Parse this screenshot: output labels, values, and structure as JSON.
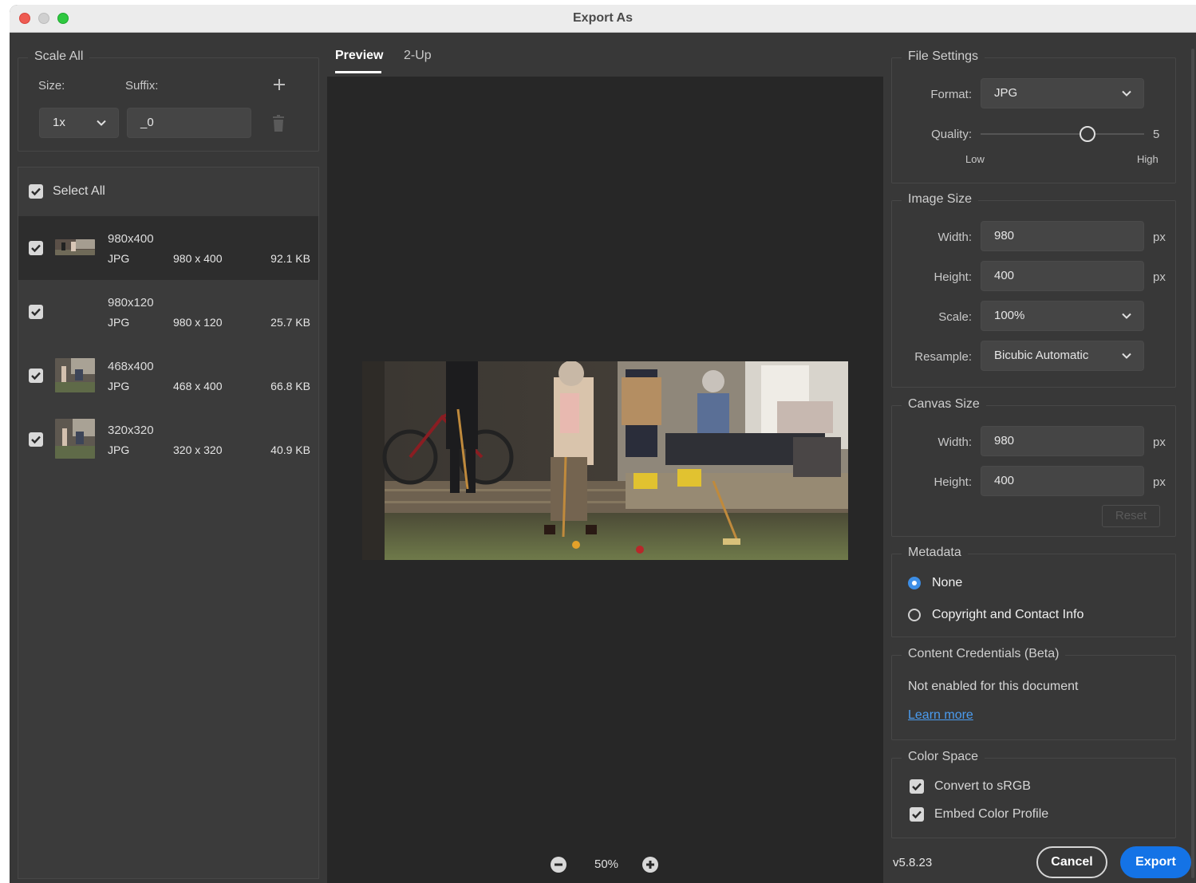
{
  "window": {
    "title": "Export As"
  },
  "scale_all": {
    "title": "Scale All",
    "size_label": "Size:",
    "suffix_label": "Suffix:",
    "size_value": "1x",
    "suffix_value": "_0"
  },
  "assets": {
    "select_all_label": "Select All",
    "items": [
      {
        "name": "980x400",
        "format": "JPG",
        "dimensions": "980 x 400",
        "filesize": "92.1 KB",
        "checked": true,
        "selected": true
      },
      {
        "name": "980x120",
        "format": "JPG",
        "dimensions": "980 x 120",
        "filesize": "25.7 KB",
        "checked": true,
        "selected": false
      },
      {
        "name": "468x400",
        "format": "JPG",
        "dimensions": "468 x 400",
        "filesize": "66.8 KB",
        "checked": true,
        "selected": false
      },
      {
        "name": "320x320",
        "format": "JPG",
        "dimensions": "320 x 320",
        "filesize": "40.9 KB",
        "checked": true,
        "selected": false
      }
    ]
  },
  "preview": {
    "tabs": [
      {
        "label": "Preview",
        "active": true
      },
      {
        "label": "2-Up",
        "active": false
      }
    ],
    "zoom_level": "50%"
  },
  "file_settings": {
    "title": "File Settings",
    "format_label": "Format:",
    "format_value": "JPG",
    "quality_label": "Quality:",
    "quality_value": "5",
    "quality_fraction": 0.67,
    "quality_low": "Low",
    "quality_high": "High"
  },
  "image_size": {
    "title": "Image Size",
    "width_label": "Width:",
    "width_value": "980",
    "height_label": "Height:",
    "height_value": "400",
    "scale_label": "Scale:",
    "scale_value": "100%",
    "resample_label": "Resample:",
    "resample_value": "Bicubic Automatic",
    "unit": "px"
  },
  "canvas_size": {
    "title": "Canvas Size",
    "width_label": "Width:",
    "width_value": "980",
    "height_label": "Height:",
    "height_value": "400",
    "unit": "px",
    "reset_label": "Reset"
  },
  "metadata": {
    "title": "Metadata",
    "options": [
      {
        "label": "None",
        "selected": true
      },
      {
        "label": "Copyright and Contact Info",
        "selected": false
      }
    ]
  },
  "content_credentials": {
    "title": "Content Credentials (Beta)",
    "status": "Not enabled for this document",
    "link": "Learn more"
  },
  "color_space": {
    "title": "Color Space",
    "convert_label": "Convert to sRGB",
    "convert_checked": true,
    "embed_label": "Embed Color Profile",
    "embed_checked": true
  },
  "footer": {
    "version": "v5.8.23",
    "cancel_label": "Cancel",
    "export_label": "Export"
  },
  "colors": {
    "accent": "#1473e6",
    "radio_selected": "#3d8ee6",
    "link": "#4b9cf0",
    "panel_bg": "#383838",
    "preview_bg": "#272727"
  }
}
